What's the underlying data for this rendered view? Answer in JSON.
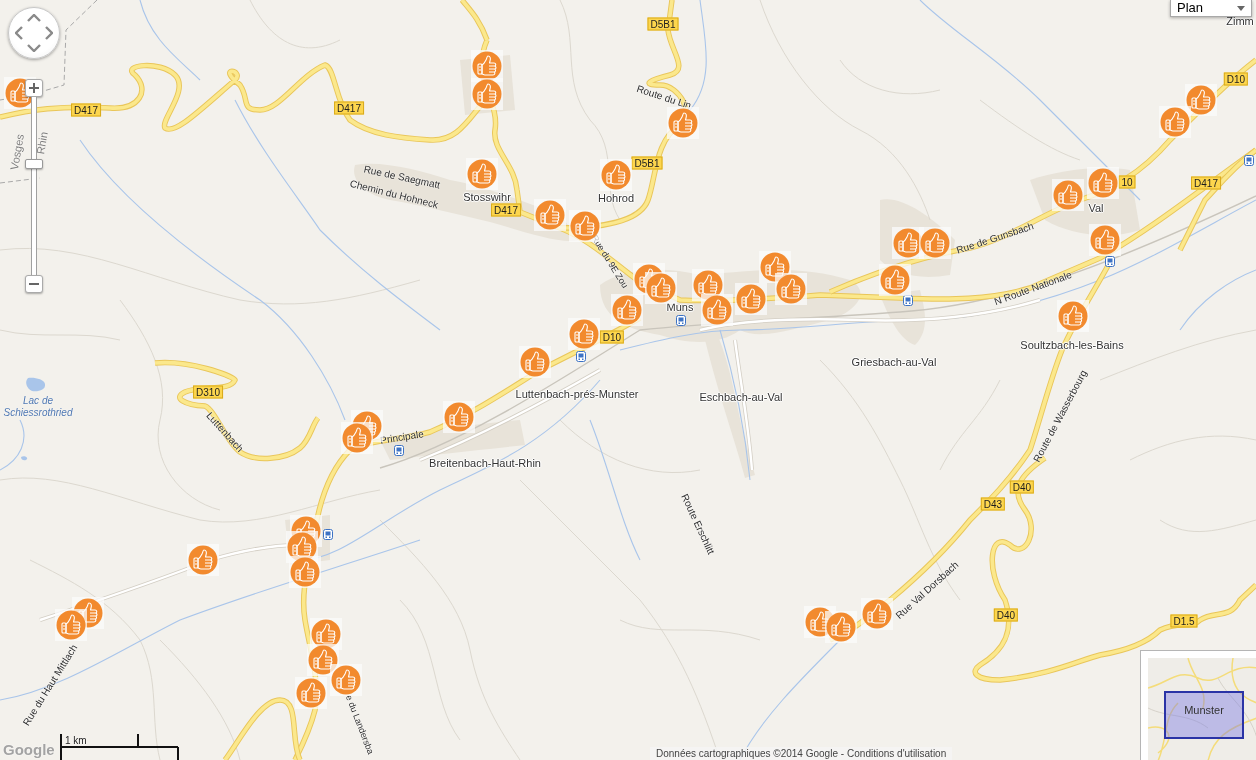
{
  "map_controls": {
    "zoom_slider": {
      "level": 0.63
    },
    "map_type": {
      "value": "Plan"
    }
  },
  "place_labels": [
    "Stosswihr",
    "Hohrod",
    "Muns",
    "Luttenbach-prés-Munster",
    "Eschbach-au-Val",
    "Griesbach-au-Val",
    "Soultzbach-les-Bains",
    "Breitenbach-Haut-Rhin",
    "Zimm",
    "Val"
  ],
  "street_labels": [
    "Rue de Saegmatt",
    "Chemin du Hohneck",
    "Route du Lin",
    "Rue du 9E Zou",
    "Rue de Gunsbach",
    "N Route Nationale",
    "Route de Wasserbourg",
    "Rue Val Dorsbach",
    "Route Erschlitt",
    "Luttenbach",
    "Principale",
    "Rue du Haut Mittlach",
    "e du Landersba"
  ],
  "region_labels": [
    "Vosges",
    "Rhin"
  ],
  "lake_label": "Lac de Schiessrothried",
  "road_shields": [
    "D5B1",
    "D417",
    "D417",
    "D417",
    "D5B1",
    "D10",
    "D310",
    "D10",
    "D417",
    "10",
    "D43",
    "D40",
    "D40",
    "D1.5"
  ],
  "overview_map": {
    "label": "Munster"
  },
  "scale": {
    "label": "1 km"
  },
  "logo": "Google",
  "attribution": {
    "text": "Données cartographiques ©2014 Google -",
    "link": "Conditions d'utilisation"
  }
}
